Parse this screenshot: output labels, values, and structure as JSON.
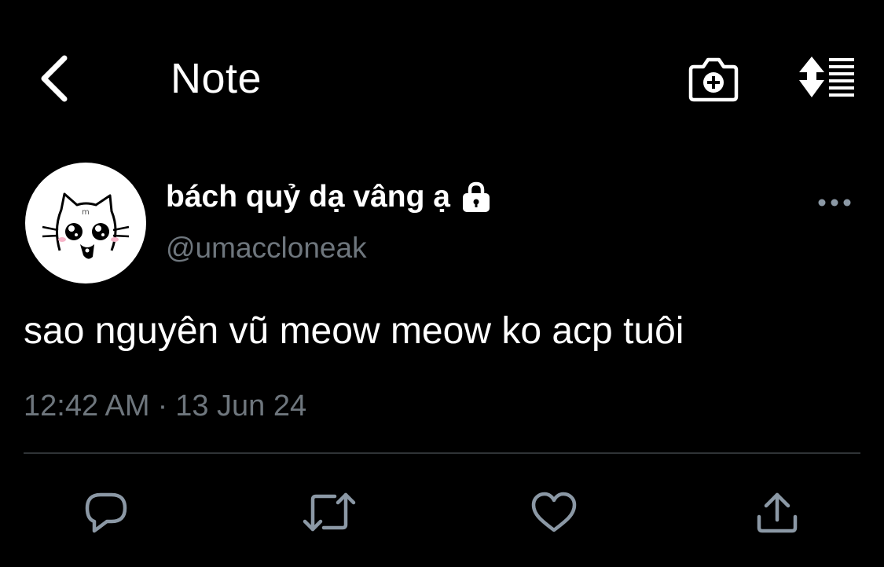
{
  "header": {
    "title": "Note",
    "back_icon": "chevron-left-icon",
    "camera_icon": "camera-add-icon",
    "sort_icon": "sort-list-icon"
  },
  "author": {
    "display_name": "bách quỷ dạ vâng ạ",
    "handle": "@umaccloneak",
    "protected_icon": "lock-icon",
    "avatar": "cat-face-avatar"
  },
  "tweet": {
    "text": "sao nguyên vũ meow meow ko acp tuôi",
    "time": "12:42 AM",
    "separator": "·",
    "date": "13 Jun 24"
  },
  "actions": {
    "reply_icon": "reply-icon",
    "retweet_icon": "retweet-icon",
    "like_icon": "heart-icon",
    "share_icon": "share-icon",
    "more_icon": "more-dots-icon"
  },
  "colors": {
    "background": "#000000",
    "text_primary": "#ffffff",
    "text_secondary": "#6e767d",
    "icon": "#8b98a5",
    "divider": "#2f3336"
  }
}
